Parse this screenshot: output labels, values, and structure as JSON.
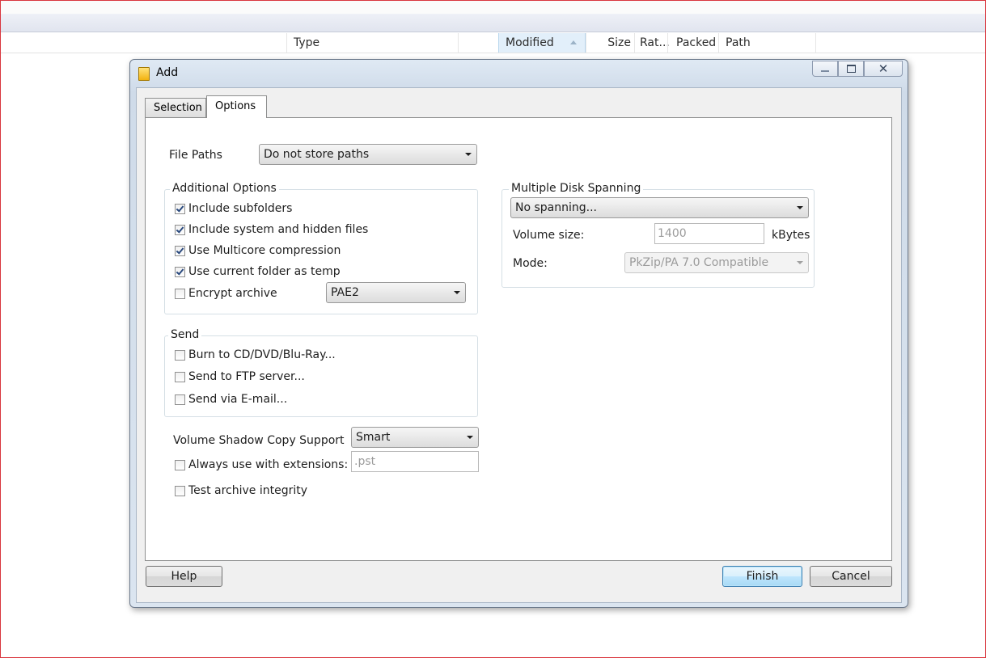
{
  "background": {
    "columns": {
      "type": "Type",
      "modified": "Modified",
      "size": "Size",
      "ratio": "Rat...",
      "packed": "Packed",
      "path": "Path"
    }
  },
  "dialog": {
    "title": "Add",
    "tabs": [
      "Selection",
      "Options"
    ],
    "active_tab": "Options",
    "file_paths": {
      "label": "File Paths",
      "value": "Do not store paths"
    },
    "additional_options": {
      "title": "Additional Options",
      "items": [
        {
          "label": "Include subfolders",
          "checked": true
        },
        {
          "label": "Include system and hidden files",
          "checked": true
        },
        {
          "label": "Use Multicore compression",
          "checked": true
        },
        {
          "label": "Use current folder as temp",
          "checked": true
        },
        {
          "label": "Encrypt archive",
          "checked": false
        }
      ],
      "encryption_method": "PAE2"
    },
    "send": {
      "title": "Send",
      "items": [
        {
          "label": "Burn to CD/DVD/Blu-Ray...",
          "checked": false
        },
        {
          "label": "Send to FTP server...",
          "checked": false
        },
        {
          "label": "Send via E-mail...",
          "checked": false
        }
      ]
    },
    "shadow_copy": {
      "label": "Volume Shadow Copy Support",
      "value": "Smart",
      "always_label": "Always use with extensions:",
      "always_checked": false,
      "extensions_placeholder": ".pst"
    },
    "test_integrity": {
      "label": "Test archive integrity",
      "checked": false
    },
    "spanning": {
      "title": "Multiple Disk Spanning",
      "value": "No spanning...",
      "volume_label": "Volume size:",
      "volume_value": "1400",
      "volume_unit": "kBytes",
      "mode_label": "Mode:",
      "mode_value": "PkZip/PA 7.0 Compatible"
    },
    "buttons": {
      "help": "Help",
      "finish": "Finish",
      "cancel": "Cancel"
    }
  }
}
